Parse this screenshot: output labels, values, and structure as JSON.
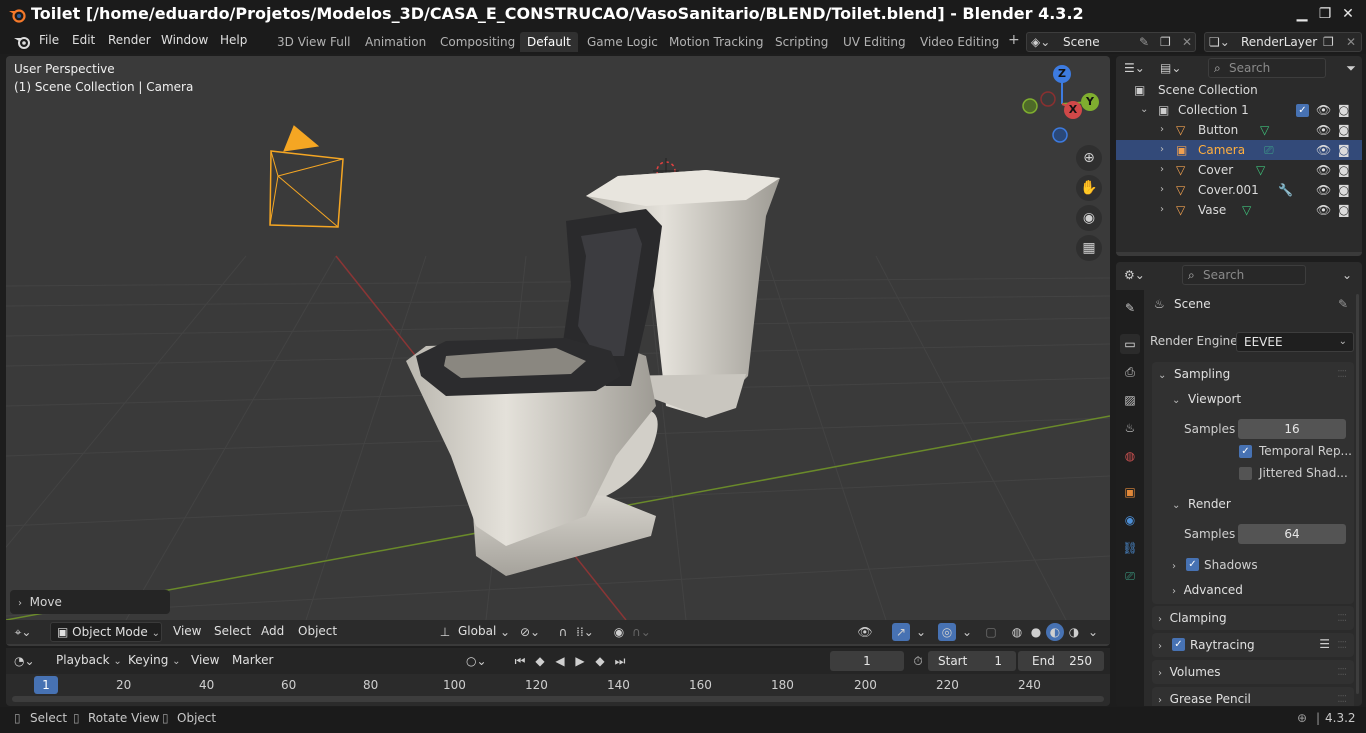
{
  "window": {
    "title": "Toilet [/home/eduardo/Projetos/Modelos_3D/CASA_E_CONSTRUCAO/VasoSanitario/BLEND/Toilet.blend] - Blender 4.3.2",
    "minimize": "▁",
    "maximize": "❐",
    "close": "✕"
  },
  "menu": {
    "file": "File",
    "edit": "Edit",
    "render": "Render",
    "window": "Window",
    "help": "Help"
  },
  "workspaces": [
    "3D View Full",
    "Animation",
    "Compositing",
    "Default",
    "Game Logic",
    "Motion Tracking",
    "Scripting",
    "UV Editing",
    "Video Editing"
  ],
  "active_workspace": "Default",
  "add_workspace": "+",
  "scene_field": "Scene",
  "view_layer_field": "RenderLayer",
  "viewport": {
    "perspective": "User Perspective",
    "collection_info": "(1) Scene Collection | Camera",
    "last_op_panel": "Move",
    "gizmo": {
      "z": "Z",
      "y": "Y",
      "x": "X"
    }
  },
  "viewport_header": {
    "mode": "Object Mode",
    "view": "View",
    "select": "Select",
    "add": "Add",
    "object": "Object",
    "orientation": "Global"
  },
  "timeline": {
    "playback": "Playback",
    "keying": "Keying",
    "view": "View",
    "marker": "Marker",
    "current_frame": "1",
    "start_label": "Start",
    "start": "1",
    "end_label": "End",
    "end": "250",
    "ruler_current": "1",
    "ruler_ticks": [
      "20",
      "40",
      "60",
      "80",
      "100",
      "120",
      "140",
      "160",
      "180",
      "200",
      "220",
      "240"
    ]
  },
  "statusbar": {
    "select": "Select",
    "rotate": "Rotate View",
    "object": "Object",
    "version": "4.3.2"
  },
  "outliner": {
    "search_placeholder": "Search",
    "scene_collection": "Scene Collection",
    "collection": "Collection 1",
    "objects": [
      {
        "name": "Button",
        "selected": false,
        "color": "#f0a050"
      },
      {
        "name": "Camera",
        "selected": true,
        "color": "#f0a050"
      },
      {
        "name": "Cover",
        "selected": false,
        "color": "#f0a050"
      },
      {
        "name": "Cover.001",
        "selected": false,
        "color": "#f0a050"
      },
      {
        "name": "Vase",
        "selected": false,
        "color": "#f0a050"
      }
    ]
  },
  "properties": {
    "search_placeholder": "Search",
    "context": "Scene",
    "render_engine_label": "Render Engine",
    "render_engine": "EEVEE",
    "sampling": "Sampling",
    "viewport": "Viewport",
    "viewport_samples_label": "Samples",
    "viewport_samples": "16",
    "temporal_reprojection": "Temporal Rep...",
    "jittered_shadows": "Jittered Shad...",
    "render": "Render",
    "render_samples_label": "Samples",
    "render_samples": "64",
    "shadows": "Shadows",
    "advanced": "Advanced",
    "clamping": "Clamping",
    "raytracing": "Raytracing",
    "volumes": "Volumes",
    "grease_pencil": "Grease Pencil"
  },
  "colors": {
    "accent": "#4772b3",
    "selection": "#334a79",
    "camera_orange": "#f5a623"
  }
}
